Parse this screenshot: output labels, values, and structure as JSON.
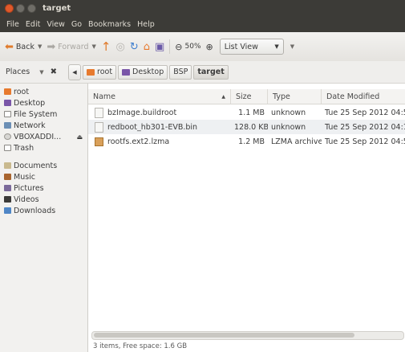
{
  "window": {
    "title": "target"
  },
  "menubar": [
    "File",
    "Edit",
    "View",
    "Go",
    "Bookmarks",
    "Help"
  ],
  "toolbar": {
    "back_label": "Back",
    "forward_label": "Forward",
    "zoom_label": "50%",
    "view_mode": "List View"
  },
  "sidebar": {
    "header_label": "Places",
    "items": [
      {
        "label": "root",
        "icon": "home-folder-icon"
      },
      {
        "label": "Desktop",
        "icon": "desktop-icon"
      },
      {
        "label": "File System",
        "icon": "filesystem-icon"
      },
      {
        "label": "Network",
        "icon": "network-icon"
      },
      {
        "label": "VBOXADDI...",
        "icon": "optical-disc-icon"
      },
      {
        "label": "Trash",
        "icon": "trash-icon"
      }
    ],
    "bookmarks": [
      {
        "label": "Documents",
        "icon": "documents-folder-icon"
      },
      {
        "label": "Music",
        "icon": "music-folder-icon"
      },
      {
        "label": "Pictures",
        "icon": "pictures-folder-icon"
      },
      {
        "label": "Videos",
        "icon": "videos-folder-icon"
      },
      {
        "label": "Downloads",
        "icon": "downloads-folder-icon"
      }
    ]
  },
  "breadcrumb": [
    "root",
    "Desktop",
    "BSP",
    "target"
  ],
  "columns": {
    "name": "Name",
    "size": "Size",
    "type": "Type",
    "date": "Date Modified"
  },
  "files": [
    {
      "name": "bzImage.buildroot",
      "size": "1.1 MB",
      "type": "unknown",
      "date": "Tue 25 Sep 2012 04:5"
    },
    {
      "name": "redboot_hb301-EVB.bin",
      "size": "128.0 KB",
      "type": "unknown",
      "date": "Tue 25 Sep 2012 04:1"
    },
    {
      "name": "rootfs.ext2.lzma",
      "size": "1.2 MB",
      "type": "LZMA archive",
      "date": "Tue 25 Sep 2012 04:5"
    }
  ],
  "status": "3 items, Free space: 1.6 GB",
  "colors": {
    "titlebar": "#3c3b37",
    "close_button": "#e0592b",
    "home_icon": "#e77a2e"
  }
}
